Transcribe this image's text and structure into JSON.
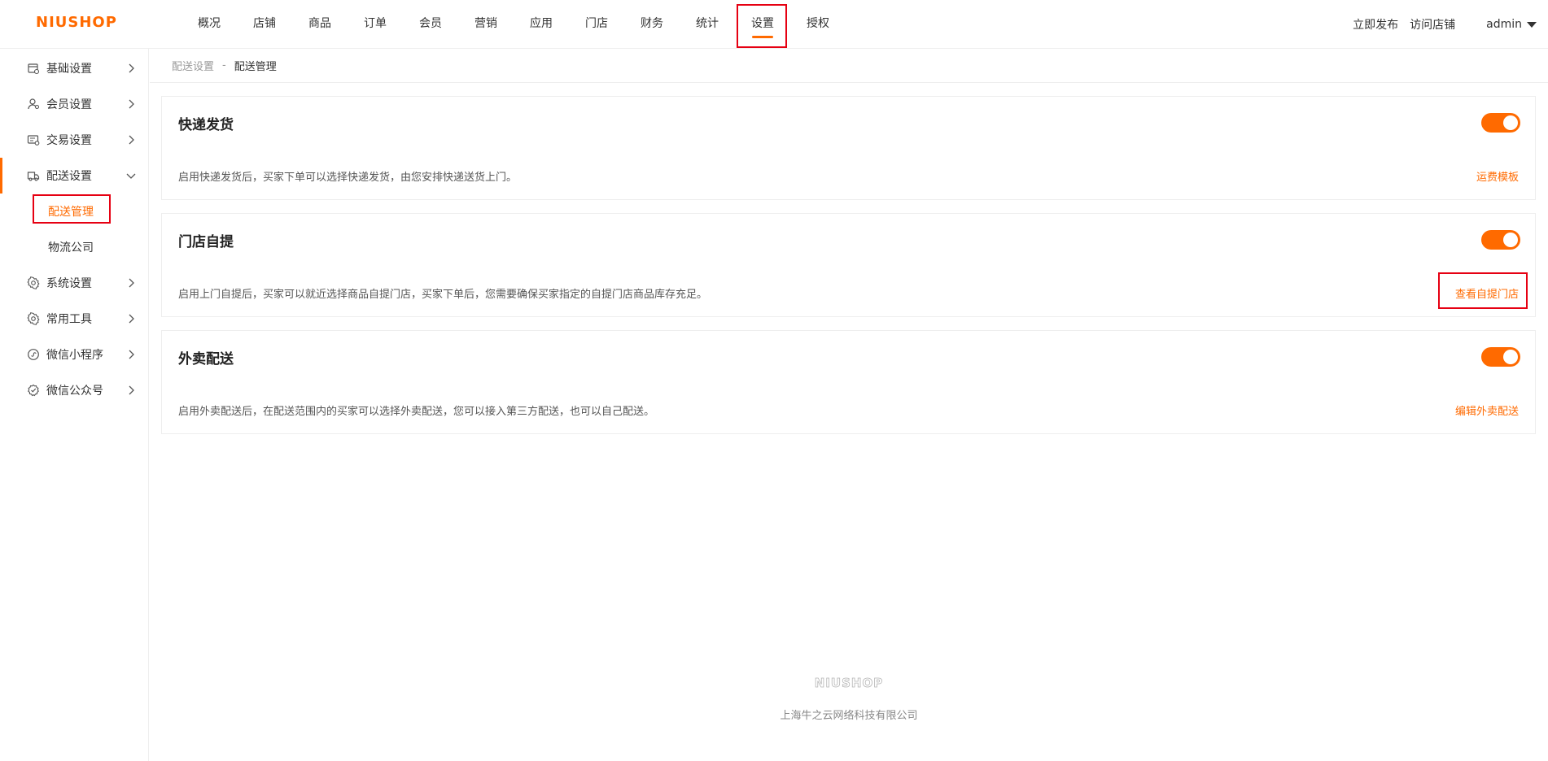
{
  "brand": {
    "logo": "NIUSHOP",
    "accent": "#ff6a00",
    "highlight": "#e60012"
  },
  "nav": {
    "items": [
      "概况",
      "店铺",
      "商品",
      "订单",
      "会员",
      "营销",
      "应用",
      "门店",
      "财务",
      "统计",
      "设置",
      "授权"
    ],
    "active": "设置"
  },
  "top_right": {
    "publish": "立即发布",
    "visit": "访问店铺",
    "user": "admin"
  },
  "sidebar": {
    "items": [
      {
        "label": "基础设置",
        "icon": "store-settings-icon"
      },
      {
        "label": "会员设置",
        "icon": "member-icon"
      },
      {
        "label": "交易设置",
        "icon": "trade-icon"
      },
      {
        "label": "配送设置",
        "icon": "delivery-truck-icon"
      },
      {
        "label": "系统设置",
        "icon": "gear-icon"
      },
      {
        "label": "常用工具",
        "icon": "tools-gear-icon"
      },
      {
        "label": "微信小程序",
        "icon": "mini-program-icon"
      },
      {
        "label": "微信公众号",
        "icon": "official-account-icon"
      }
    ],
    "sub_items": [
      "配送管理",
      "物流公司"
    ],
    "active_sub": "配送管理"
  },
  "breadcrumb": {
    "parent": "配送设置",
    "separator": "-",
    "current": "配送管理"
  },
  "cards": [
    {
      "title": "快递发货",
      "enabled": true,
      "desc": "启用快递发货后，买家下单可以选择快递发货，由您安排快递送货上门。",
      "link": "运费模板"
    },
    {
      "title": "门店自提",
      "enabled": true,
      "desc": "启用上门自提后，买家可以就近选择商品自提门店，买家下单后，您需要确保买家指定的自提门店商品库存充足。",
      "link": "查看自提门店"
    },
    {
      "title": "外卖配送",
      "enabled": true,
      "desc": "启用外卖配送后，在配送范围内的买家可以选择外卖配送，您可以接入第三方配送，也可以自己配送。",
      "link": "编辑外卖配送"
    }
  ],
  "footer": {
    "logo": "NIUSHOP",
    "company": "上海牛之云网络科技有限公司"
  }
}
